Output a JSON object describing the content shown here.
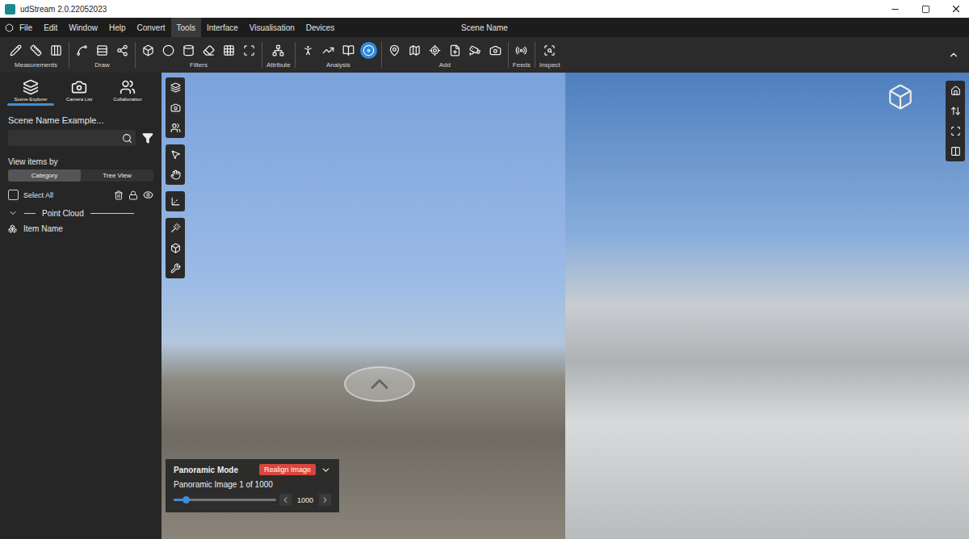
{
  "window": {
    "title": "udStream 2.0.22052023",
    "scene_name": "Scene Name"
  },
  "menu": [
    {
      "label": "File",
      "selected": false
    },
    {
      "label": "Edit",
      "selected": false
    },
    {
      "label": "Window",
      "selected": false
    },
    {
      "label": "Help",
      "selected": false
    },
    {
      "label": "Convert",
      "selected": false
    },
    {
      "label": "Tools",
      "selected": true
    },
    {
      "label": "Interface",
      "selected": false
    },
    {
      "label": "Visualisation",
      "selected": false
    },
    {
      "label": "Devices",
      "selected": false
    }
  ],
  "ribbon": [
    {
      "label": "Measurements",
      "tools": [
        {
          "selected": false
        },
        {
          "selected": false
        },
        {
          "selected": false
        }
      ]
    },
    {
      "label": "Draw",
      "tools": [
        {
          "selected": false
        },
        {
          "selected": false
        },
        {
          "selected": false
        }
      ]
    },
    {
      "label": "Filters",
      "tools": [
        {
          "selected": false
        },
        {
          "selected": false
        },
        {
          "selected": false
        },
        {
          "selected": false
        },
        {
          "selected": false
        },
        {
          "selected": false
        }
      ]
    },
    {
      "label": "Attribute",
      "tools": [
        {
          "selected": false
        }
      ]
    },
    {
      "label": "Analysis",
      "tools": [
        {
          "selected": false
        },
        {
          "selected": false
        },
        {
          "selected": false
        },
        {
          "selected": true
        }
      ]
    },
    {
      "label": "Add",
      "tools": [
        {
          "selected": false
        },
        {
          "selected": false
        },
        {
          "selected": false
        },
        {
          "selected": false
        },
        {
          "selected": false
        },
        {
          "selected": false
        }
      ]
    },
    {
      "label": "Feeds",
      "tools": [
        {
          "selected": false
        }
      ]
    },
    {
      "label": "Inspect",
      "tools": [
        {
          "selected": false
        }
      ]
    }
  ],
  "sidebar": {
    "tabs": [
      {
        "label": "Scene Explorer",
        "selected": true
      },
      {
        "label": "Camera List",
        "selected": false
      },
      {
        "label": "Collaboration",
        "selected": false
      }
    ],
    "scene_title": "Scene Name Example...",
    "search": {
      "placeholder": ""
    },
    "view_by": {
      "label": "View items by",
      "options": [
        {
          "label": "Category",
          "selected": true
        },
        {
          "label": "Tree View",
          "selected": false
        }
      ]
    },
    "select_all": {
      "label": "Select All",
      "checked": false
    },
    "tree": [
      {
        "label": "Point Cloud",
        "expanded": true,
        "items": [
          {
            "label": "Item Name"
          }
        ]
      }
    ]
  },
  "panorama": {
    "title": "Panoramic Mode",
    "action": "Realign Image",
    "caption": "Panoramic Image 1 of 1000",
    "level": 0.12,
    "value": "1000"
  }
}
